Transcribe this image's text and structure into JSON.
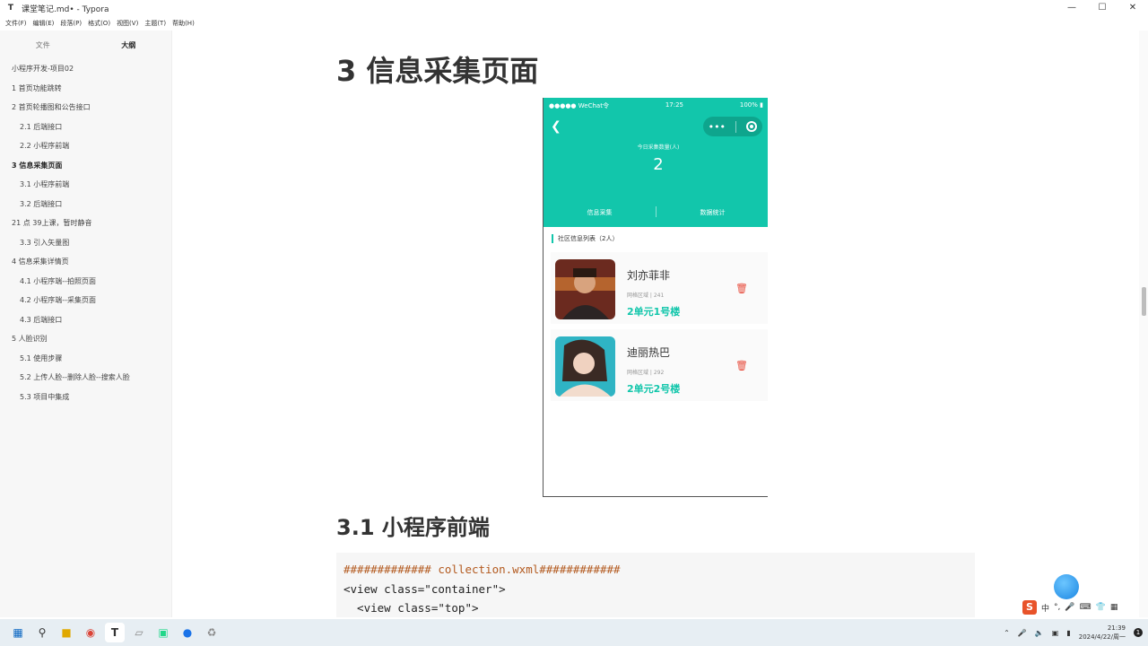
{
  "window": {
    "title": "课堂笔记.md• - Typora",
    "app_icon": "typora-icon"
  },
  "menu": [
    "文件(F)",
    "编辑(E)",
    "段落(P)",
    "格式(O)",
    "视图(V)",
    "主题(T)",
    "帮助(H)"
  ],
  "sidebar": {
    "tabs": [
      {
        "label": "文件",
        "active": false
      },
      {
        "label": "大纲",
        "active": true
      }
    ],
    "outline": [
      {
        "label": "小程序开发-项目02",
        "level": 1
      },
      {
        "label": "1 首页功能跳转",
        "level": 1
      },
      {
        "label": "2 首页轮播图和公告接口",
        "level": 1
      },
      {
        "label": "2.1 后端接口",
        "level": 2
      },
      {
        "label": "2.2 小程序前端",
        "level": 2
      },
      {
        "label": "3 信息采集页面",
        "level": 1,
        "active": true
      },
      {
        "label": "3.1 小程序前端",
        "level": 2
      },
      {
        "label": "3.2 后端接口",
        "level": 2
      },
      {
        "label": "21 点 39上课，暂时静音",
        "level": 1
      },
      {
        "label": "3.3 引入矢量图",
        "level": 2
      },
      {
        "label": "4 信息采集详情页",
        "level": 1
      },
      {
        "label": "4.1 小程序端--拍照页面",
        "level": 2
      },
      {
        "label": "4.2 小程序端--采集页面",
        "level": 2
      },
      {
        "label": "4.3 后端接口",
        "level": 2
      },
      {
        "label": "5 人脸识别",
        "level": 1
      },
      {
        "label": "5.1 使用步骤",
        "level": 2
      },
      {
        "label": "5.2 上传人脸--删除人脸--搜索人脸",
        "level": 2
      },
      {
        "label": "5.3 项目中集成",
        "level": 2
      }
    ],
    "footer_back": "<",
    "footer_source": "</>"
  },
  "editor": {
    "heading2": "3 信息采集页面",
    "heading3": "3.1 小程序前端",
    "code_lines": [
      "############# collection.wxml############",
      "<view class=\"container\">",
      "  <view class=\"top\">"
    ]
  },
  "phone": {
    "status_left": "●●●●● WeChat令",
    "status_time": "17:25",
    "status_battery": "100%",
    "count_label": "今日采集数量(人)",
    "count_value": "2",
    "nav": [
      "信息采集",
      "数据统计"
    ],
    "list_title": "社区信息列表（2人）",
    "cards": [
      {
        "name": "刘亦菲非",
        "sub": "网格区域 | 241",
        "addr": "2单元1号楼"
      },
      {
        "name": "迪丽热巴",
        "sub": "网格区域 | 292",
        "addr": "2单元2号楼"
      }
    ],
    "accent": "#12c6ab"
  },
  "taskbar": {
    "icons": [
      "windows-start-icon",
      "search-icon",
      "file-explorer-icon",
      "chrome-icon",
      "typora-icon",
      "app-icon",
      "pycharm-icon",
      "browser-icon",
      "recycle-icon"
    ],
    "ime_lang": "中",
    "time": "21:39",
    "date": "2024/4/22/周一"
  }
}
